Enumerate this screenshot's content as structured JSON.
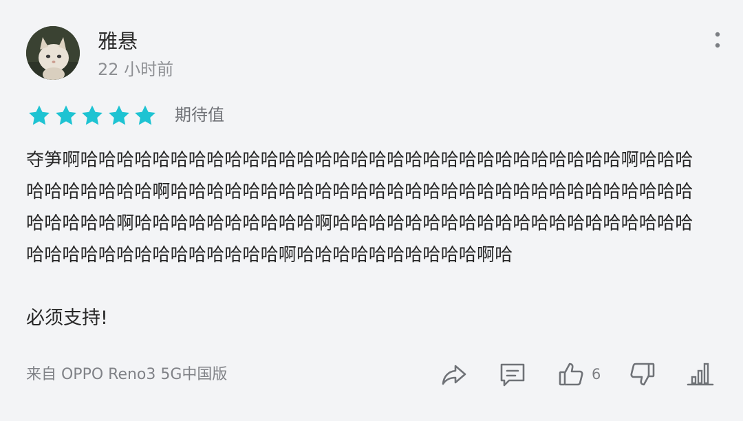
{
  "review": {
    "username": "雅悬",
    "time": "22 小时前",
    "rating": 5,
    "rating_max": 5,
    "rating_label": "期待值",
    "body": "夺笋啊哈哈哈哈哈哈哈哈哈哈哈哈哈哈哈哈哈哈哈哈哈哈哈哈哈哈哈哈哈哈啊哈哈哈哈哈哈哈哈哈哈啊哈哈哈哈哈哈哈哈哈哈哈哈哈哈哈哈哈哈哈哈哈哈哈哈哈哈哈哈哈哈哈哈哈哈啊哈哈哈哈哈哈哈哈哈哈啊哈哈哈哈哈哈哈哈哈哈哈哈哈哈哈哈哈哈哈哈哈哈哈哈哈哈哈哈哈哈哈哈哈哈啊哈哈哈哈哈哈哈哈哈哈啊哈",
    "body_extra": "必须支持!",
    "device": "来自 OPPO Reno3 5G中国版",
    "like_count": "6"
  },
  "icons": {
    "more": "more-vertical-icon",
    "star": "star-icon",
    "share": "share-icon",
    "comment": "comment-icon",
    "like": "thumbs-up-icon",
    "dislike": "thumbs-down-icon",
    "stats": "bar-chart-icon"
  },
  "colors": {
    "star": "#1ec3d2",
    "text": "#262626",
    "muted": "#8d8f93",
    "icon": "#6f7277",
    "background": "#f3f4f6"
  }
}
